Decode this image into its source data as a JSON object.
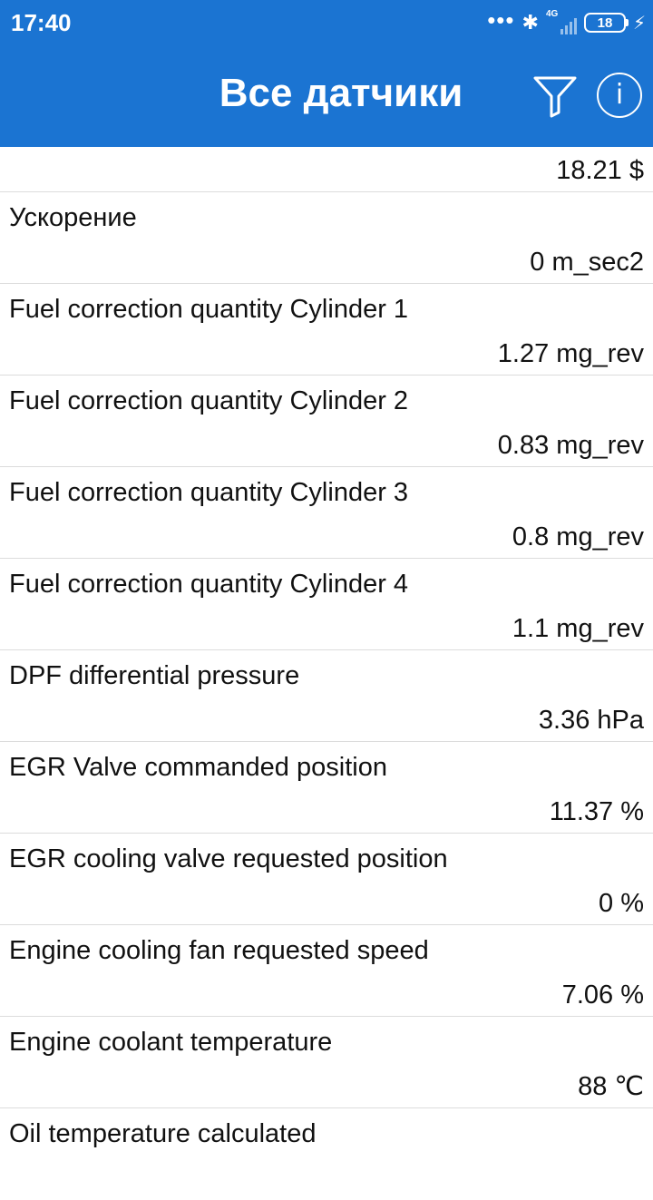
{
  "status_bar": {
    "time": "17:40",
    "network": "4G",
    "battery": "18",
    "icons": [
      "dots-icon",
      "bluetooth-icon",
      "signal-icon",
      "battery-icon",
      "charging-icon"
    ]
  },
  "header": {
    "title": "Все датчики",
    "background": "#1b74d2",
    "actions": [
      "filter-icon",
      "info-icon"
    ],
    "info_glyph": "i"
  },
  "top_value": "18.21 $",
  "sensors": [
    {
      "name": "Ускорение",
      "value": "0 m_sec2"
    },
    {
      "name": "Fuel correction quantity Cylinder 1",
      "value": "1.27 mg_rev"
    },
    {
      "name": "Fuel correction quantity Cylinder 2",
      "value": "0.83 mg_rev"
    },
    {
      "name": "Fuel correction quantity Cylinder 3",
      "value": "0.8 mg_rev"
    },
    {
      "name": "Fuel correction quantity Cylinder 4",
      "value": "1.1 mg_rev"
    },
    {
      "name": "DPF differential pressure",
      "value": "3.36 hPa"
    },
    {
      "name": "EGR Valve commanded position",
      "value": "11.37 %"
    },
    {
      "name": "EGR cooling valve requested position",
      "value": "0 %"
    },
    {
      "name": "Engine cooling fan requested speed",
      "value": "7.06 %"
    },
    {
      "name": "Engine coolant temperature",
      "value": "88 ℃"
    },
    {
      "name": "Oil temperature calculated",
      "value": ""
    }
  ]
}
